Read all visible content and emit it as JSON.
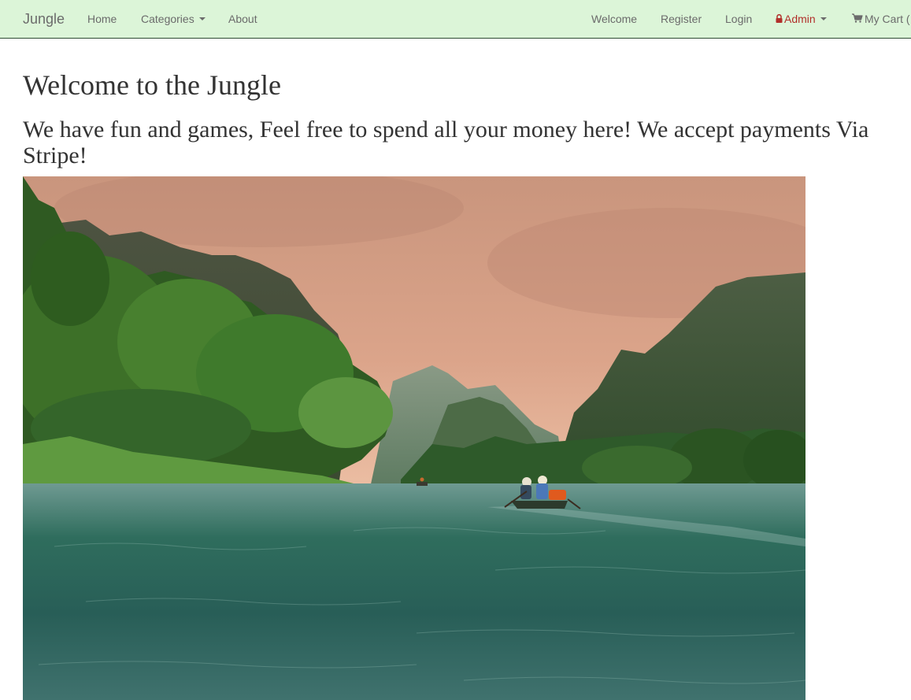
{
  "navbar": {
    "brand": "Jungle",
    "left_items": {
      "home": "Home",
      "categories": "Categories",
      "about": "About"
    },
    "right_items": {
      "welcome": "Welcome",
      "register": "Register",
      "login": "Login",
      "admin": "Admin",
      "cart": "My Cart ("
    },
    "background_color": "#dcf5d8",
    "admin_color": "#b2302b"
  },
  "main": {
    "title": "Welcome to the Jungle",
    "subtitle": "We have fun and games, Feel free to spend all your money here! We accept payments Via Stripe!",
    "hero_image": "river-boat-karst-mountains-landscape"
  }
}
